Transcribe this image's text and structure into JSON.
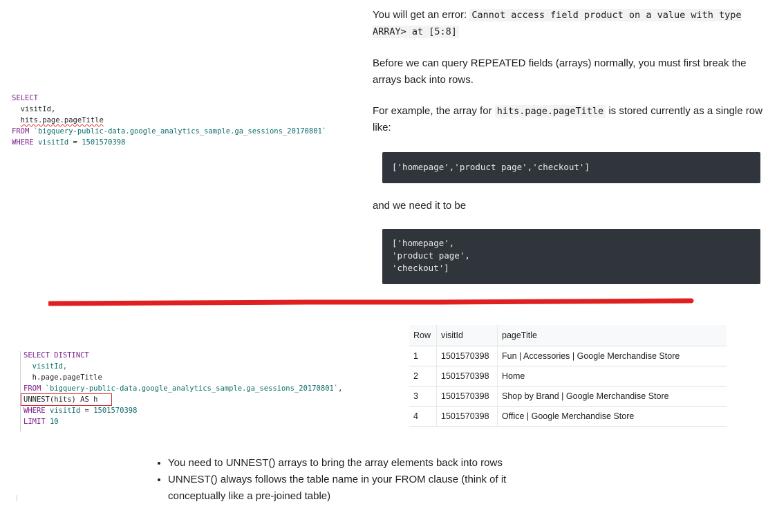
{
  "sql_top": {
    "lines": [
      "SELECT",
      "visitId,",
      "hits.page.pageTitle",
      "FROM",
      "`bigquery-public-data.google_analytics_sample.ga_sessions_20170801`",
      "WHERE",
      "visitId",
      "=",
      "1501570398"
    ]
  },
  "right_text": {
    "error_prefix": "You will get an error: ",
    "error_code": "Cannot access field product on a value with type ARRAY> at [5:8]",
    "para2": "Before we can query REPEATED fields (arrays) normally, you must first break the arrays back into rows.",
    "para3_prefix": "For example, the array for ",
    "para3_code": "hits.page.pageTitle",
    "para3_suffix": " is stored currently as a single row like:",
    "codeblock1": "['homepage','product page','checkout']",
    "para4": "and we need it to be",
    "codeblock2": "['homepage',\n'product page',\n'checkout']"
  },
  "sql_bottom": {
    "select_distinct": "SELECT DISTINCT",
    "visit_id": "visitId,",
    "page_title": "h.page.pageTitle",
    "from": "FROM",
    "table": "`bigquery-public-data.google_analytics_sample.ga_sessions_20170801`",
    "comma": ",",
    "unnest": "UNNEST(hits) AS h",
    "where": "WHERE",
    "where_field": "visitId",
    "eq": "=",
    "where_value": "1501570398",
    "limit": "LIMIT",
    "limit_value": "10"
  },
  "results": {
    "headers": [
      "Row",
      "visitId",
      "pageTitle"
    ],
    "rows": [
      [
        "1",
        "1501570398",
        "Fun | Accessories | Google Merchandise Store"
      ],
      [
        "2",
        "1501570398",
        "Home"
      ],
      [
        "3",
        "1501570398",
        "Shop by Brand | Google Merchandise Store"
      ],
      [
        "4",
        "1501570398",
        "Office | Google Merchandise Store"
      ]
    ]
  },
  "bullets": [
    "You need to UNNEST() arrays to bring the array elements back into rows",
    "UNNEST() always follows the table name in your FROM clause (think of it conceptually like a pre-joined table)"
  ],
  "colors": {
    "keyword": "#7a1f8c",
    "literal": "#0b6b6b",
    "divider": "#e02020",
    "codeblock_bg": "#2f353b"
  }
}
